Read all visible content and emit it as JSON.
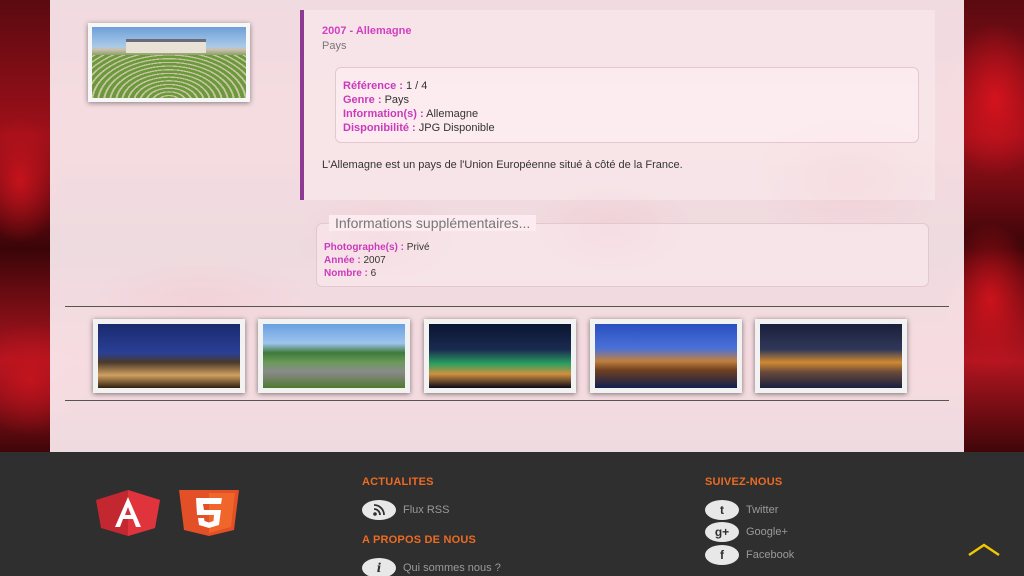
{
  "detail": {
    "title": "2007 - Allemagne",
    "subtitle": "Pays",
    "info": [
      {
        "label": "Référence :",
        "value": " 1 / 4"
      },
      {
        "label": "Genre :",
        "value": " Pays"
      },
      {
        "label": "Information(s) :",
        "value": " Allemagne"
      },
      {
        "label": "Disponibilité :",
        "value": " JPG Disponible"
      }
    ],
    "description": "L'Allemagne est un pays de l'Union Européenne situé à côté de la France."
  },
  "extra": {
    "legend": "Informations supplémentaires...",
    "rows": [
      {
        "label": "Photographe(s) :",
        "value": " Privé"
      },
      {
        "label": "Année :",
        "value": " 2007"
      },
      {
        "label": "Nombre :",
        "value": " 6"
      }
    ]
  },
  "footer": {
    "actualites_title": "ACTUALITES",
    "rss_label": "Flux RSS",
    "apropos_title": "A PROPOS DE NOUS",
    "qui_label": "Qui sommes nous ?",
    "suivez_title": "SUIVEZ-NOUS",
    "social": [
      {
        "icon": "twitter-icon",
        "glyph": "t",
        "label": "Twitter"
      },
      {
        "icon": "google-plus-icon",
        "glyph": "g+",
        "label": "Google+"
      },
      {
        "icon": "facebook-icon",
        "glyph": "f",
        "label": "Facebook"
      }
    ]
  },
  "colors": {
    "accent_pink": "#c93bbc",
    "accent_purple": "#8e3a93",
    "accent_orange": "#ec6b23",
    "footer_bg": "#2f2f2f"
  }
}
